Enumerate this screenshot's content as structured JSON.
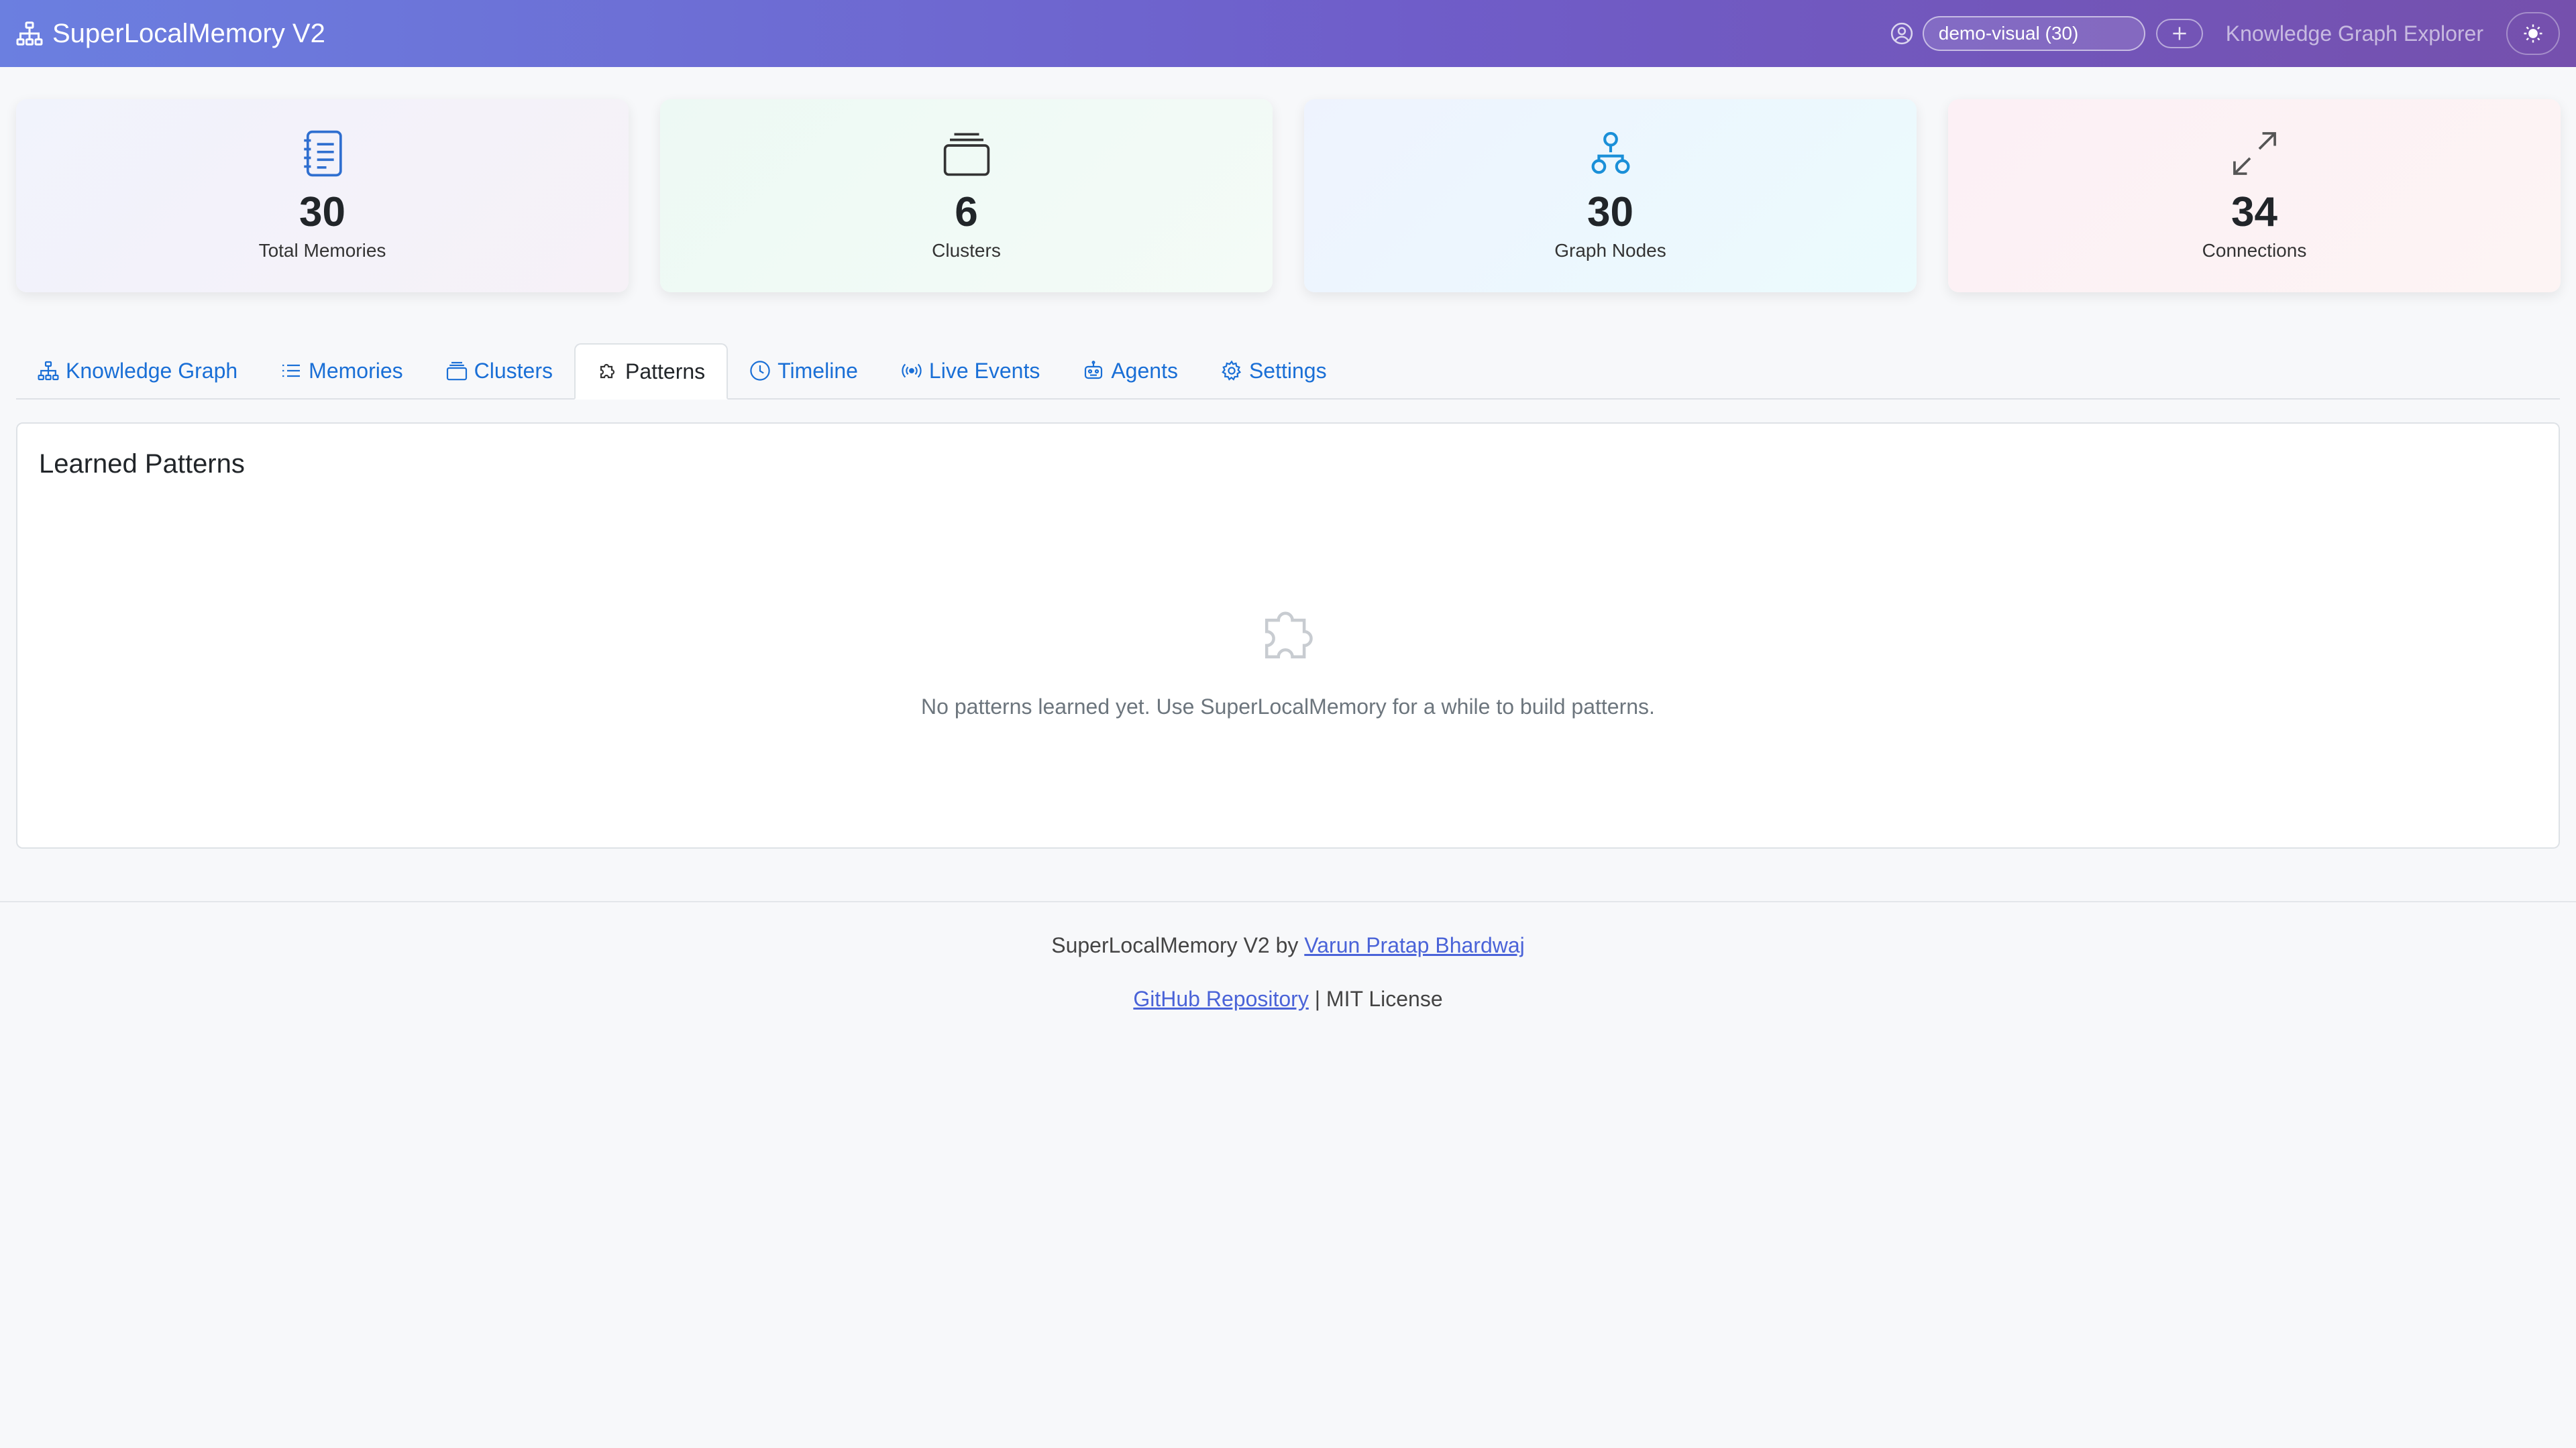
{
  "navbar": {
    "brand": "SuperLocalMemory V2",
    "brand_icon": "diagram-3-icon",
    "profile_select_value": "demo-visual (30)",
    "subtitle": "Knowledge Graph Explorer",
    "theme_icon": "sun-icon",
    "add_icon": "plus-icon"
  },
  "stats": [
    {
      "value": "30",
      "label": "Total Memories",
      "icon": "journal-text-icon",
      "color": "#2f6fd0"
    },
    {
      "value": "6",
      "label": "Clusters",
      "icon": "collection-icon",
      "color": "#333333"
    },
    {
      "value": "30",
      "label": "Graph Nodes",
      "icon": "diagram-icon",
      "color": "#1a8fd8"
    },
    {
      "value": "34",
      "label": "Connections",
      "icon": "arrows-angle-icon",
      "color": "#555555"
    }
  ],
  "tabs": [
    {
      "label": "Knowledge Graph",
      "icon": "diagram-3-icon",
      "active": false
    },
    {
      "label": "Memories",
      "icon": "list-icon",
      "active": false
    },
    {
      "label": "Clusters",
      "icon": "collection-icon",
      "active": false
    },
    {
      "label": "Patterns",
      "icon": "puzzle-icon",
      "active": true
    },
    {
      "label": "Timeline",
      "icon": "clock-icon",
      "active": false
    },
    {
      "label": "Live Events",
      "icon": "broadcast-icon",
      "active": false
    },
    {
      "label": "Agents",
      "icon": "robot-icon",
      "active": false
    },
    {
      "label": "Settings",
      "icon": "gear-icon",
      "active": false
    }
  ],
  "patterns_panel": {
    "title": "Learned Patterns",
    "empty_icon": "puzzle-icon",
    "empty_message": "No patterns learned yet. Use SuperLocalMemory for a while to build patterns."
  },
  "footer": {
    "line1_prefix": "SuperLocalMemory V2 by ",
    "author_link": "Varun Pratap Bhardwaj",
    "repo_link": "GitHub Repository",
    "line2_suffix": " | MIT License",
    "link_color": "#4a63d8"
  }
}
